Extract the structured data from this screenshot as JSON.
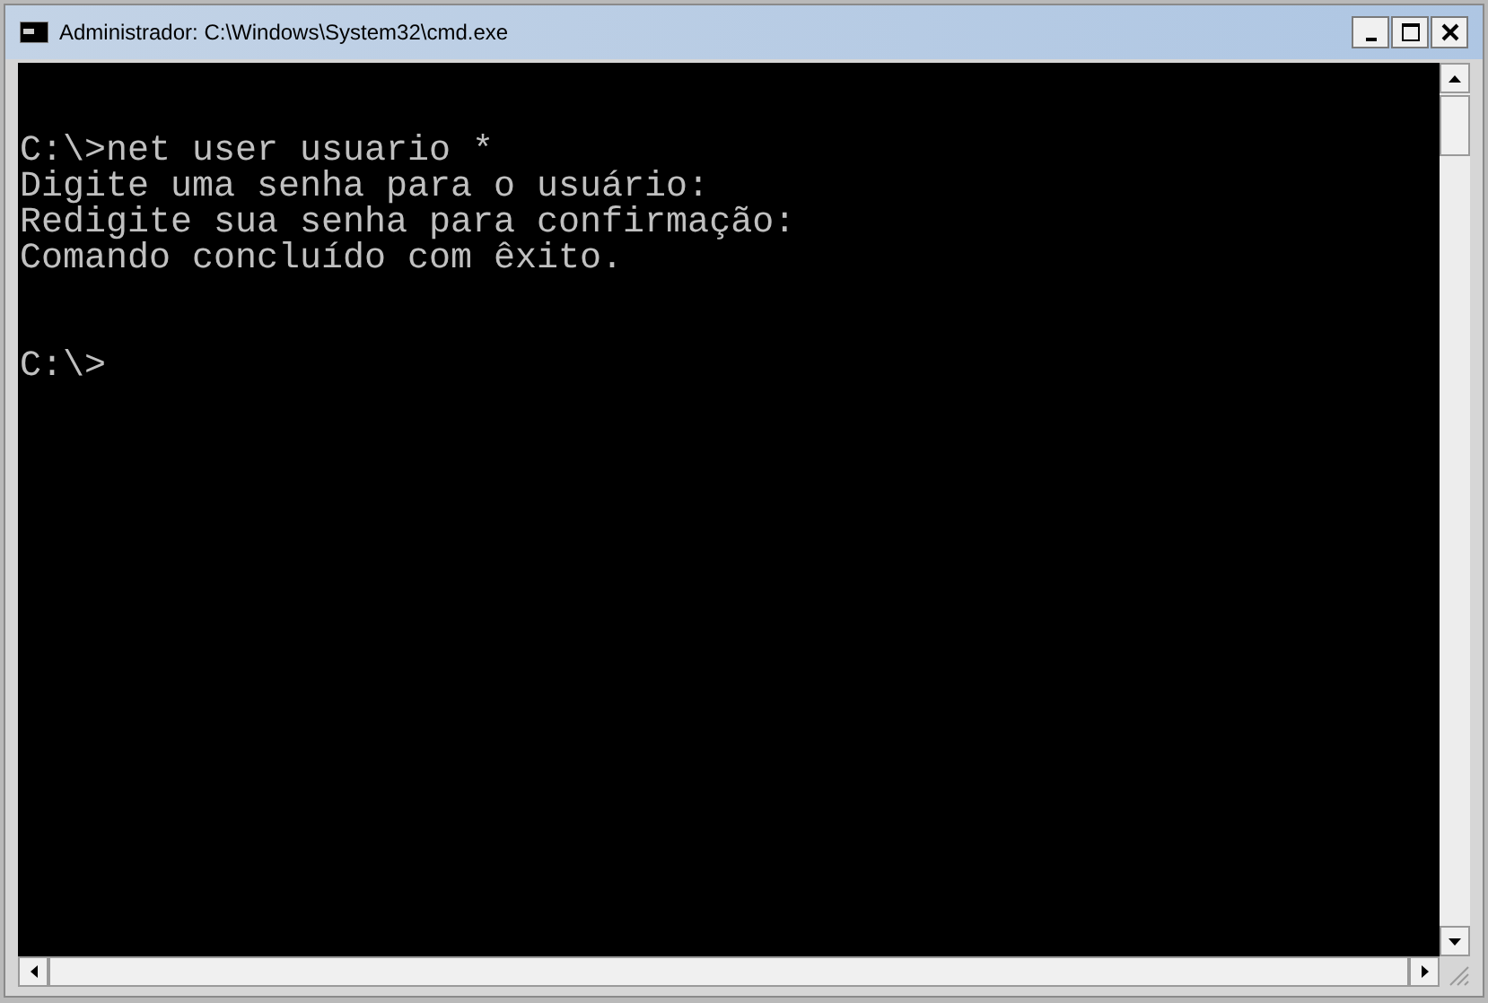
{
  "window": {
    "title": "Administrador: C:\\Windows\\System32\\cmd.exe"
  },
  "console": {
    "lines": [
      "C:\\>net user usuario *",
      "Digite uma senha para o usuário:",
      "Redigite sua senha para confirmação:",
      "Comando concluído com êxito."
    ],
    "prompt": "C:\\>"
  }
}
